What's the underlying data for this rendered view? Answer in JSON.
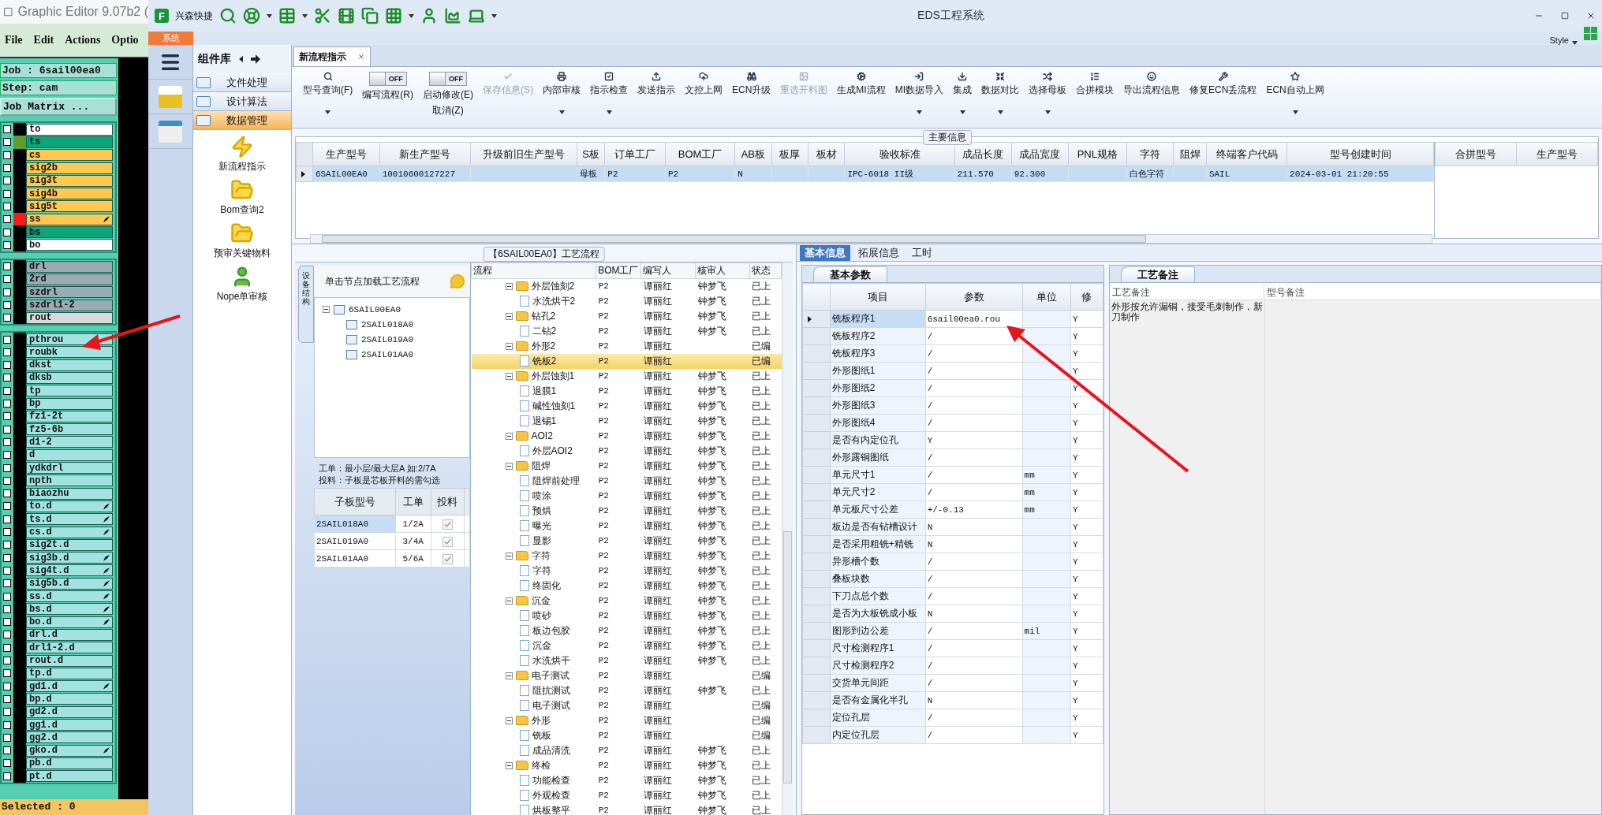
{
  "genesis": {
    "title": "Graphic Editor 9.07b2 (",
    "menu": [
      "File",
      "Edit",
      "Actions",
      "Optio"
    ],
    "job": "Job : 6sail00ea0",
    "step": "Step: cam",
    "matrix_button": "Job Matrix ...",
    "layer_groups": [
      [
        {
          "name": "to",
          "color": "#ffffff",
          "checked": false,
          "linked": false
        },
        {
          "name": "ts",
          "color": "#0aa67a",
          "swatch": {
            "color": "#5aa02c"
          },
          "checked": false,
          "linked": false
        },
        {
          "name": "cs",
          "color": "#ffc850",
          "checked": false,
          "linked": false
        },
        {
          "name": "sig2b",
          "color": "#ffc850",
          "checked": false,
          "linked": false
        },
        {
          "name": "sig3t",
          "color": "#ffc850",
          "checked": false,
          "linked": false
        },
        {
          "name": "sig4b",
          "color": "#ffc850",
          "checked": false,
          "linked": false
        },
        {
          "name": "sig5t",
          "color": "#ffc850",
          "checked": false,
          "linked": false
        },
        {
          "name": "ss",
          "color": "#ffc850",
          "swatch": {
            "color": "#ff1a1a"
          },
          "checked": false,
          "linked": true
        },
        {
          "name": "bs",
          "color": "#0aa67a",
          "checked": false,
          "linked": false
        },
        {
          "name": "bo",
          "color": "#ffffff",
          "checked": false,
          "linked": false
        }
      ],
      [
        {
          "name": "drl",
          "color": "#9aabb4",
          "checked": false,
          "linked": false
        },
        {
          "name": "2rd",
          "color": "#9aabb4",
          "checked": false,
          "linked": false
        },
        {
          "name": "szdrl",
          "color": "#9aabb4",
          "checked": false,
          "linked": false
        },
        {
          "name": "szdrl1-2",
          "color": "#9aabb4",
          "checked": false,
          "linked": false
        },
        {
          "name": "rout",
          "color": "#d9d9d9",
          "checked": false,
          "linked": false
        }
      ],
      [
        {
          "name": "pthrou",
          "color": "#a2e2e0",
          "checked": false,
          "linked": false
        },
        {
          "name": "roubk",
          "color": "#a2e2e0",
          "checked": false,
          "linked": false
        },
        {
          "name": "dkst",
          "color": "#a2e2e0",
          "checked": false,
          "linked": false
        },
        {
          "name": "dksb",
          "color": "#a2e2e0",
          "checked": false,
          "linked": false
        },
        {
          "name": "tp",
          "color": "#a2e2e0",
          "checked": false,
          "linked": false
        },
        {
          "name": "bp",
          "color": "#a2e2e0",
          "checked": false,
          "linked": false
        },
        {
          "name": "fz1-2t",
          "color": "#a2e2e0",
          "checked": false,
          "linked": false
        },
        {
          "name": "fz5-6b",
          "color": "#a2e2e0",
          "checked": false,
          "linked": false
        },
        {
          "name": "d1-2",
          "color": "#a2e2e0",
          "checked": false,
          "linked": false
        },
        {
          "name": "d",
          "color": "#a2e2e0",
          "checked": false,
          "linked": false
        },
        {
          "name": "ydkdrl",
          "color": "#a2e2e0",
          "checked": false,
          "linked": false
        },
        {
          "name": "npth",
          "color": "#a2e2e0",
          "checked": false,
          "linked": false
        },
        {
          "name": "biaozhu",
          "color": "#a2e2e0",
          "checked": false,
          "linked": false
        },
        {
          "name": "to.d",
          "color": "#a2e2e0",
          "checked": false,
          "linked": true
        },
        {
          "name": "ts.d",
          "color": "#a2e2e0",
          "checked": false,
          "linked": true
        },
        {
          "name": "cs.d",
          "color": "#a2e2e0",
          "checked": false,
          "linked": true
        },
        {
          "name": "sig2t.d",
          "color": "#a2e2e0",
          "checked": false,
          "linked": false
        },
        {
          "name": "sig3b.d",
          "color": "#a2e2e0",
          "checked": false,
          "linked": true
        },
        {
          "name": "sig4t.d",
          "color": "#a2e2e0",
          "checked": false,
          "linked": true
        },
        {
          "name": "sig5b.d",
          "color": "#a2e2e0",
          "checked": false,
          "linked": true
        },
        {
          "name": "ss.d",
          "color": "#a2e2e0",
          "checked": false,
          "linked": true
        },
        {
          "name": "bs.d",
          "color": "#a2e2e0",
          "checked": false,
          "linked": true
        },
        {
          "name": "bo.d",
          "color": "#a2e2e0",
          "checked": false,
          "linked": true
        },
        {
          "name": "drl.d",
          "color": "#a2e2e0",
          "checked": false,
          "linked": false
        },
        {
          "name": "drl1-2.d",
          "color": "#a2e2e0",
          "checked": false,
          "linked": false
        },
        {
          "name": "rout.d",
          "color": "#a2e2e0",
          "checked": false,
          "linked": false
        },
        {
          "name": "tp.d",
          "color": "#a2e2e0",
          "checked": false,
          "linked": false
        },
        {
          "name": "gd1.d",
          "color": "#a2e2e0",
          "checked": false,
          "linked": true
        },
        {
          "name": "bp.d",
          "color": "#a2e2e0",
          "checked": false,
          "linked": false
        },
        {
          "name": "gd2.d",
          "color": "#a2e2e0",
          "checked": false,
          "linked": false
        },
        {
          "name": "gg1.d",
          "color": "#a2e2e0",
          "checked": false,
          "linked": false
        },
        {
          "name": "gg2.d",
          "color": "#a2e2e0",
          "checked": false,
          "linked": false
        },
        {
          "name": "gko.d",
          "color": "#a2e2e0",
          "checked": false,
          "linked": true
        },
        {
          "name": "pb.d",
          "color": "#a2e2e0",
          "checked": false,
          "linked": false
        },
        {
          "name": "pt.d",
          "color": "#a2e2e0",
          "checked": false,
          "linked": false
        }
      ]
    ],
    "status": "Selected : 0"
  },
  "eds": {
    "logo_text": "F",
    "quick_label": "兴森快捷",
    "title": "EDS工程系统",
    "system_tab": "系统",
    "style_label": "Style",
    "library": {
      "title": "组件库",
      "sections": [
        {
          "label": "文件处理",
          "selected": false
        },
        {
          "label": "设计算法",
          "selected": false
        },
        {
          "label": "数据管理",
          "selected": true
        }
      ],
      "items": [
        "新流程指示",
        "Bom查询2",
        "预审关键物料",
        "Nope单审核"
      ]
    },
    "doc_tab": "新流程指示",
    "ribbon": [
      {
        "kind": "button",
        "label": "型号查询(F)",
        "disabled": false,
        "dropdown": true
      },
      {
        "kind": "toggle",
        "label": "编写流程(R)",
        "toggle_text": "OFF",
        "on": false
      },
      {
        "kind": "toggle",
        "label": "启动修改(E)",
        "label2": "取消(Z)",
        "toggle_text": "OFF",
        "on": false
      },
      {
        "kind": "button",
        "label": "保存信息(S)",
        "disabled": true,
        "dropdown": false
      },
      {
        "kind": "button",
        "label": "内部审核",
        "disabled": false,
        "dropdown": true
      },
      {
        "kind": "button",
        "label": "指示检查",
        "disabled": false,
        "dropdown": true
      },
      {
        "kind": "button",
        "label": "发送指示",
        "disabled": false,
        "dropdown": false
      },
      {
        "kind": "button",
        "label": "文控上网",
        "disabled": false,
        "dropdown": false
      },
      {
        "kind": "button",
        "label": "ECN升级",
        "disabled": false,
        "dropdown": false
      },
      {
        "kind": "button",
        "label": "重选开料图",
        "disabled": true,
        "dropdown": false
      },
      {
        "kind": "button",
        "label": "生成MI流程",
        "disabled": false,
        "dropdown": false
      },
      {
        "kind": "button",
        "label": "MI数据导入",
        "disabled": false,
        "dropdown": true
      },
      {
        "kind": "button",
        "label": "集成",
        "disabled": false,
        "dropdown": true
      },
      {
        "kind": "button",
        "label": "数据对比",
        "disabled": false,
        "dropdown": true
      },
      {
        "kind": "button",
        "label": "选择母板",
        "disabled": false,
        "dropdown": true
      },
      {
        "kind": "button",
        "label": "合拼模块",
        "disabled": false,
        "dropdown": false
      },
      {
        "kind": "button",
        "label": "导出流程信息",
        "disabled": false,
        "dropdown": false
      },
      {
        "kind": "button",
        "label": "修复ECN丢流程",
        "disabled": false,
        "dropdown": false
      },
      {
        "kind": "button",
        "label": "ECN自动上网",
        "disabled": false,
        "dropdown": true
      }
    ],
    "main_info": {
      "title": "主要信息",
      "columns": [
        "生产型号",
        "新生产型号",
        "升级前旧生产型号",
        "S板",
        "订单工厂",
        "BOM工厂",
        "AB板",
        "板厚",
        "板材",
        "验收标准",
        "成品长度",
        "成品宽度",
        "PNL规格",
        "字符",
        "阻焊",
        "终端客户代码",
        "型号创建时间"
      ],
      "rows": [
        {
          "selected": true,
          "cells": [
            "6SAIL00EA0",
            "10010600127227",
            null,
            "母板",
            "P2",
            "P2",
            "N",
            null,
            null,
            "IPC-6018 II级",
            "211.570",
            "92.300",
            null,
            "白色字符",
            null,
            "SAIL",
            "2024-03-01 21:20:55"
          ]
        }
      ],
      "side_columns": [
        "合拼型号",
        "生产型号"
      ]
    },
    "process": {
      "title": "【6SAIL00EA0】工艺流程",
      "side_tab": "设备结构",
      "hint": "单击节点加载工艺流程",
      "tree": {
        "name": "6SAIL00EA0",
        "expanded": true,
        "children": [
          "2SAIL018A0",
          "2SAIL019A0",
          "2SAIL01AA0"
        ]
      },
      "notes": [
        "工单：最小层/最大层A 如:2/7A",
        "投料：子板是芯板开料的需勾选"
      ],
      "sub_columns": [
        "子板型号",
        "工单",
        "投料"
      ],
      "sub_rows": [
        {
          "model": "2SAIL018A0",
          "order": "1/2A",
          "checked": true,
          "selected": true
        },
        {
          "model": "2SAIL019A0",
          "order": "3/4A",
          "checked": true,
          "selected": false
        },
        {
          "model": "2SAIL01AA0",
          "order": "5/6A",
          "checked": true,
          "selected": false
        }
      ],
      "flow_columns": [
        "流程",
        "BOM工厂",
        "编写人",
        "核审人",
        "状态"
      ],
      "flow": [
        {
          "name": "外层蚀刻2",
          "bom": "P2",
          "writer": "谭丽红",
          "reviewer": "钟梦飞",
          "status": "已上",
          "expanded": true,
          "selected": false,
          "children": [
            {
              "name": "水洗烘干2",
              "bom": "P2",
              "writer": "谭丽红",
              "reviewer": "钟梦飞",
              "status": "已上",
              "selected": false
            }
          ]
        },
        {
          "name": "钻孔2",
          "bom": "P2",
          "writer": "谭丽红",
          "reviewer": "钟梦飞",
          "status": "已上",
          "expanded": true,
          "selected": false,
          "children": [
            {
              "name": "二钻2",
              "bom": "P2",
              "writer": "谭丽红",
              "reviewer": "钟梦飞",
              "status": "已上",
              "selected": false
            }
          ]
        },
        {
          "name": "外形2",
          "bom": "P2",
          "writer": "谭丽红",
          "status": "已编",
          "expanded": true,
          "selected": false,
          "children": [
            {
              "name": "铣板2",
              "bom": "P2",
              "writer": "谭丽红",
              "status": "已编",
              "selected": true
            }
          ]
        },
        {
          "name": "外层蚀刻1",
          "bom": "P2",
          "writer": "谭丽红",
          "reviewer": "钟梦飞",
          "status": "已上",
          "expanded": true,
          "selected": false,
          "children": [
            {
              "name": "退膜1",
              "bom": "P2",
              "writer": "谭丽红",
              "reviewer": "钟梦飞",
              "status": "已上",
              "selected": false
            },
            {
              "name": "碱性蚀刻1",
              "bom": "P2",
              "writer": "谭丽红",
              "reviewer": "钟梦飞",
              "status": "已上",
              "selected": false
            },
            {
              "name": "退锡1",
              "bom": "P2",
              "writer": "谭丽红",
              "reviewer": "钟梦飞",
              "status": "已上",
              "selected": false
            }
          ]
        },
        {
          "name": "AOI2",
          "bom": "P2",
          "writer": "谭丽红",
          "reviewer": "钟梦飞",
          "status": "已上",
          "expanded": true,
          "selected": false,
          "children": [
            {
              "name": "外层AOI2",
              "bom": "P2",
              "writer": "谭丽红",
              "reviewer": "钟梦飞",
              "status": "已上",
              "selected": false
            }
          ]
        },
        {
          "name": "阻焊",
          "bom": "P2",
          "writer": "谭丽红",
          "reviewer": "钟梦飞",
          "status": "已上",
          "expanded": true,
          "selected": false,
          "children": [
            {
              "name": "阻焊前处理",
              "bom": "P2",
              "writer": "谭丽红",
              "reviewer": "钟梦飞",
              "status": "已上",
              "selected": false
            },
            {
              "name": "喷涂",
              "bom": "P2",
              "writer": "谭丽红",
              "reviewer": "钟梦飞",
              "status": "已上",
              "selected": false
            },
            {
              "name": "预烘",
              "bom": "P2",
              "writer": "谭丽红",
              "reviewer": "钟梦飞",
              "status": "已上",
              "selected": false
            },
            {
              "name": "曝光",
              "bom": "P2",
              "writer": "谭丽红",
              "reviewer": "钟梦飞",
              "status": "已上",
              "selected": false
            },
            {
              "name": "显影",
              "bom": "P2",
              "writer": "谭丽红",
              "reviewer": "钟梦飞",
              "status": "已上",
              "selected": false
            }
          ]
        },
        {
          "name": "字符",
          "bom": "P2",
          "writer": "谭丽红",
          "reviewer": "钟梦飞",
          "status": "已上",
          "expanded": true,
          "selected": false,
          "children": [
            {
              "name": "字符",
              "bom": "P2",
              "writer": "谭丽红",
              "reviewer": "钟梦飞",
              "status": "已上",
              "selected": false
            },
            {
              "name": "终固化",
              "bom": "P2",
              "writer": "谭丽红",
              "reviewer": "钟梦飞",
              "status": "已上",
              "selected": false
            }
          ]
        },
        {
          "name": "沉金",
          "bom": "P2",
          "writer": "谭丽红",
          "reviewer": "钟梦飞",
          "status": "已上",
          "expanded": true,
          "selected": false,
          "children": [
            {
              "name": "喷砂",
              "bom": "P2",
              "writer": "谭丽红",
              "reviewer": "钟梦飞",
              "status": "已上",
              "selected": false
            },
            {
              "name": "板边包胶",
              "bom": "P2",
              "writer": "谭丽红",
              "reviewer": "钟梦飞",
              "status": "已上",
              "selected": false
            },
            {
              "name": "沉金",
              "bom": "P2",
              "writer": "谭丽红",
              "reviewer": "钟梦飞",
              "status": "已上",
              "selected": false
            },
            {
              "name": "水洗烘干",
              "bom": "P2",
              "writer": "谭丽红",
              "reviewer": "钟梦飞",
              "status": "已上",
              "selected": false
            }
          ]
        },
        {
          "name": "电子测试",
          "bom": "P2",
          "writer": "谭丽红",
          "status": "已编",
          "expanded": true,
          "selected": false,
          "children": [
            {
              "name": "阻抗测试",
              "bom": "P2",
              "writer": "谭丽红",
              "reviewer": "钟梦飞",
              "status": "已上",
              "selected": false
            },
            {
              "name": "电子测试",
              "bom": "P2",
              "writer": "谭丽红",
              "status": "已编",
              "selected": false
            }
          ]
        },
        {
          "name": "外形",
          "bom": "P2",
          "writer": "谭丽红",
          "status": "已编",
          "expanded": true,
          "selected": false,
          "children": [
            {
              "name": "铣板",
              "bom": "P2",
              "writer": "谭丽红",
              "status": "已编",
              "selected": false
            },
            {
              "name": "成品清洗",
              "bom": "P2",
              "writer": "谭丽红",
              "reviewer": "钟梦飞",
              "status": "已上",
              "selected": false
            }
          ]
        },
        {
          "name": "终检",
          "bom": "P2",
          "writer": "谭丽红",
          "reviewer": "钟梦飞",
          "status": "已上",
          "expanded": true,
          "selected": false,
          "children": [
            {
              "name": "功能检查",
              "bom": "P2",
              "writer": "谭丽红",
              "reviewer": "钟梦飞",
              "status": "已上",
              "selected": false
            },
            {
              "name": "外观检查",
              "bom": "P2",
              "writer": "谭丽红",
              "reviewer": "钟梦飞",
              "status": "已上",
              "selected": false
            },
            {
              "name": "烘板整平",
              "bom": "P2",
              "writer": "谭丽红",
              "reviewer": "钟梦飞",
              "status": "已上",
              "selected": false
            }
          ]
        }
      ]
    },
    "detail": {
      "tabs": [
        {
          "label": "基本信息",
          "selected": true
        },
        {
          "label": "拓展信息",
          "selected": false
        },
        {
          "label": "工时",
          "selected": false
        }
      ],
      "param_tab": "基本参数",
      "param_columns": [
        "项目",
        "参数",
        "单位",
        "修"
      ],
      "params": [
        {
          "item": "铣板程序1",
          "value": "6sail00ea0.rou",
          "modified": "Y",
          "selected": true
        },
        {
          "item": "铣板程序2",
          "value": "/",
          "modified": "Y",
          "selected": false
        },
        {
          "item": "铣板程序3",
          "value": "/",
          "modified": "Y",
          "selected": false
        },
        {
          "item": "外形图纸1",
          "value": "/",
          "modified": "Y",
          "selected": false
        },
        {
          "item": "外形图纸2",
          "value": "/",
          "modified": "Y",
          "selected": false
        },
        {
          "item": "外形图纸3",
          "value": "/",
          "modified": "Y",
          "selected": false
        },
        {
          "item": "外形图纸4",
          "value": "/",
          "modified": "Y",
          "selected": false
        },
        {
          "item": "是否有内定位孔",
          "value": "Y",
          "modified": "Y",
          "selected": false
        },
        {
          "item": "外形露铜图纸",
          "value": "/",
          "modified": "Y",
          "selected": false
        },
        {
          "item": "单元尺寸1",
          "value": "/",
          "unit": "mm",
          "modified": "Y",
          "selected": false
        },
        {
          "item": "单元尺寸2",
          "value": "/",
          "unit": "mm",
          "modified": "Y",
          "selected": false
        },
        {
          "item": "单元板尺寸公差",
          "value": "+/-0.13",
          "unit": "mm",
          "modified": "Y",
          "selected": false
        },
        {
          "item": "板边是否有钻槽设计",
          "value": "N",
          "modified": "Y",
          "selected": false
        },
        {
          "item": "是否采用粗铣+精铣",
          "value": "N",
          "modified": "Y",
          "selected": false
        },
        {
          "item": "异形槽个数",
          "value": "/",
          "modified": "Y",
          "selected": false
        },
        {
          "item": "叠板块数",
          "value": "/",
          "modified": "Y",
          "selected": false
        },
        {
          "item": "下刀点总个数",
          "value": "/",
          "modified": "Y",
          "selected": false
        },
        {
          "item": "是否为大板铣成小板",
          "value": "N",
          "modified": "Y",
          "selected": false
        },
        {
          "item": "图形到边公差",
          "value": "/",
          "unit": "mil",
          "modified": "Y",
          "selected": false
        },
        {
          "item": "尺寸检测程序1",
          "value": "/",
          "modified": "Y",
          "selected": false
        },
        {
          "item": "尺寸检测程序2",
          "value": "/",
          "modified": "Y",
          "selected": false
        },
        {
          "item": "交货单元间距",
          "value": "/",
          "modified": "Y",
          "selected": false
        },
        {
          "item": "是否有金属化半孔",
          "value": "N",
          "modified": "Y",
          "selected": false
        },
        {
          "item": "定位孔层",
          "value": "/",
          "modified": "Y",
          "selected": false
        },
        {
          "item": "内定位孔层",
          "value": "/",
          "modified": "Y",
          "selected": false
        }
      ],
      "remark_tab": "工艺备注",
      "remark_columns": [
        "工艺备注",
        "型号备注"
      ],
      "remark_text": "外形按允许漏铜，接受毛刺制作，新刀制作"
    }
  }
}
